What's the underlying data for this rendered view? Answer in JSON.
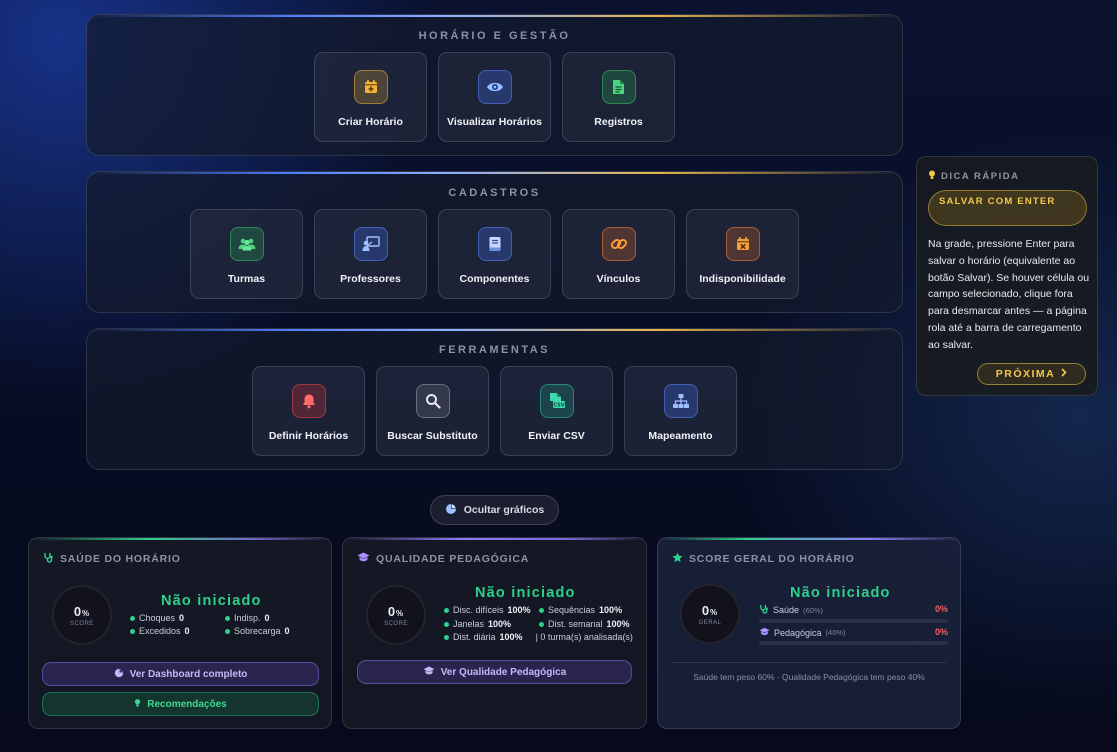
{
  "sections": {
    "horario": {
      "title": "HORÁRIO E GESTÃO",
      "tiles": [
        "Criar Horário",
        "Visualizar Horários",
        "Registros"
      ]
    },
    "cadastros": {
      "title": "CADASTROS",
      "tiles": [
        "Turmas",
        "Professores",
        "Componentes",
        "Vínculos",
        "Indisponibilidade"
      ]
    },
    "ferramentas": {
      "title": "FERRAMENTAS",
      "tiles": [
        "Definir Horários",
        "Buscar Substituto",
        "Enviar CSV",
        "Mapeamento"
      ]
    }
  },
  "tip": {
    "heading": "DICA RÁPIDA",
    "pill": "SALVAR COM ENTER",
    "body": "Na grade, pressione Enter para salvar o horário (equivalente ao botão Salvar). Se houver célula ou campo selecionado, clique fora para desmarcar antes — a página rola até a barra de carregamento ao salvar.",
    "next": "PRÓXIMA"
  },
  "toggle_label": "Ocultar gráficos",
  "saude": {
    "title": "SAÚDE DO HORÁRIO",
    "score": "0",
    "unit": "%",
    "ring_label": "SCORE",
    "status": "Não iniciado",
    "stats": [
      {
        "label": "Choques",
        "value": "0"
      },
      {
        "label": "Indisp.",
        "value": "0"
      },
      {
        "label": "Excedidos",
        "value": "0"
      },
      {
        "label": "Sobrecarga",
        "value": "0"
      }
    ],
    "dashboard_btn": "Ver Dashboard completo",
    "recs_btn": "Recomendações"
  },
  "qualidade": {
    "title": "QUALIDADE PEDAGÓGICA",
    "score": "0",
    "unit": "%",
    "ring_label": "SCORE",
    "status": "Não iniciado",
    "stats": [
      {
        "label": "Disc. difíceis",
        "value": "100%"
      },
      {
        "label": "Sequências",
        "value": "100%"
      },
      {
        "label": "Janelas",
        "value": "100%"
      },
      {
        "label": "Dist. semanal",
        "value": "100%"
      },
      {
        "label": "Dist. diária",
        "value": "100%"
      }
    ],
    "turmas_note": "| 0 turma(s) analisada(s)",
    "btn": "Ver Qualidade Pedagógica"
  },
  "geral": {
    "title": "SCORE GERAL DO HORÁRIO",
    "score": "0",
    "unit": "%",
    "ring_label": "GERAL",
    "status": "Não iniciado",
    "rows": [
      {
        "label": "Saúde",
        "weight": "(60%)",
        "value": "0%",
        "fill": 0
      },
      {
        "label": "Pedagógica",
        "weight": "(40%)",
        "value": "0%",
        "fill": 0
      }
    ],
    "footer": "Saúde tem peso 60% · Qualidade Pedagógica tem peso 40%"
  },
  "colors": {
    "accent_gold": "#f2c84b",
    "status_green": "#2ed18c",
    "alert_red": "#ff5a5a",
    "purple": "#c3b8f5"
  }
}
